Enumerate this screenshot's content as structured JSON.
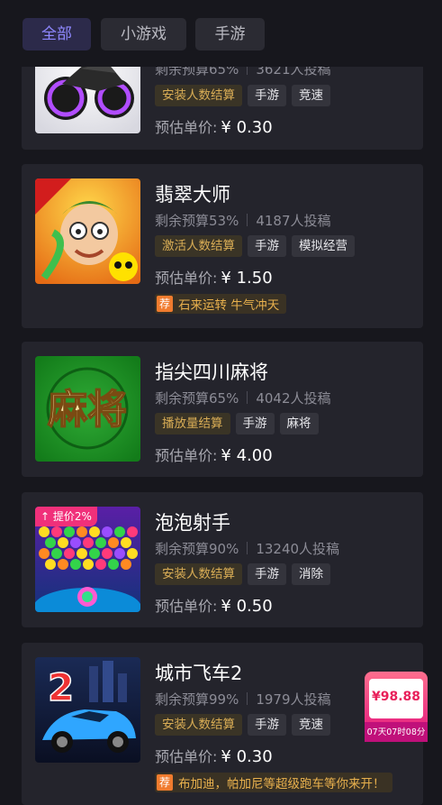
{
  "tabs": [
    {
      "label": "全部",
      "active": true
    },
    {
      "label": "小游戏",
      "active": false
    },
    {
      "label": "手游",
      "active": false
    }
  ],
  "cards": [
    {
      "title": "",
      "stats_left": "剩余预算65%",
      "stats_right": "3621人投稿",
      "tags": [
        "安装人数结算",
        "手游",
        "竞速"
      ],
      "price_label": "预估单价:",
      "price_value": "¥ 0.30",
      "promo": null,
      "thumb_icon": "motorcycle-icon"
    },
    {
      "title": "翡翠大师",
      "stats_left": "剩余预算53%",
      "stats_right": "4187人投稿",
      "tags": [
        "激活人数结算",
        "手游",
        "模拟经营"
      ],
      "price_label": "预估单价:",
      "price_value": "¥ 1.50",
      "promo": {
        "badge": "荐",
        "text": "石来运转 牛气冲天"
      },
      "thumb_icon": "jade-master-icon"
    },
    {
      "title": "指尖四川麻将",
      "stats_left": "剩余预算65%",
      "stats_right": "4042人投稿",
      "tags": [
        "播放量结算",
        "手游",
        "麻将"
      ],
      "price_label": "预估单价:",
      "price_value": "¥ 4.00",
      "promo": null,
      "thumb_text": "麻将"
    },
    {
      "title": "泡泡射手",
      "stats_left": "剩余预算90%",
      "stats_right": "13240人投稿",
      "tags": [
        "安装人数结算",
        "手游",
        "消除"
      ],
      "price_label": "预估单价:",
      "price_value": "¥ 0.50",
      "promo": null,
      "thumb_badge": "↑ 提价2%"
    },
    {
      "title": "城市飞车2",
      "stats_left": "剩余预算99%",
      "stats_right": "1979人投稿",
      "tags": [
        "安装人数结算",
        "手游",
        "竞速"
      ],
      "price_label": "预估单价:",
      "price_value": "¥ 0.30",
      "promo": {
        "badge": "荐",
        "text": "布加迪，帕加尼等超级跑车等你来开！"
      },
      "thumb_text": "2"
    }
  ],
  "floating_reward": {
    "amount": "¥98.88",
    "countdown": "07天07时08分"
  },
  "colors": {
    "accent": "#8f88ff",
    "gold_tag": "#d8ac55",
    "promo": "#e8b04d",
    "card_bg": "#24242c",
    "page_bg": "#17171d"
  }
}
